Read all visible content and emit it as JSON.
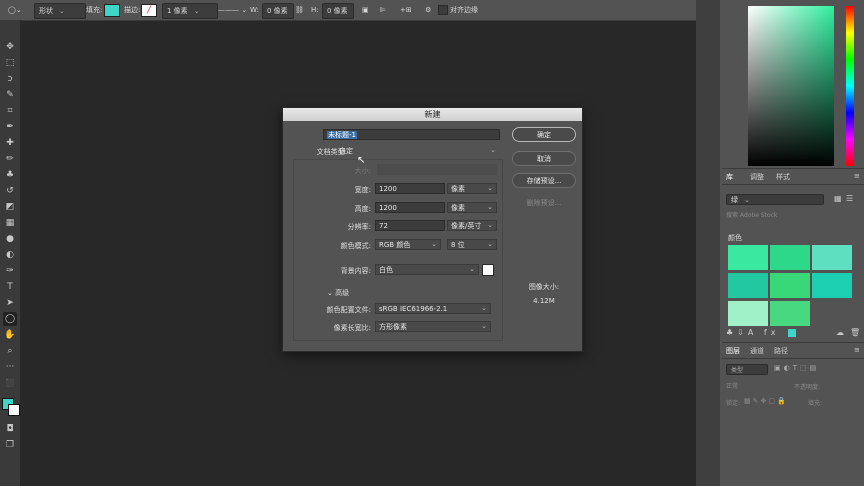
{
  "optionsbar": {
    "mode": "形状",
    "fill_label": "填充:",
    "stroke_label": "描边:",
    "stroke_width": "1 像素",
    "w_label": "W:",
    "w_value": "0 像素",
    "h_label": "H:",
    "h_value": "0 像素",
    "align_edges": "对齐边缘",
    "fill_color": "#3fd4c8"
  },
  "dialog": {
    "title": "新建",
    "name_label": "名称:",
    "name_value": "未标题-1",
    "doctype_label": "文档类型:",
    "doctype_value": "自定",
    "size_label": "大小:",
    "width_label": "宽度:",
    "width_value": "1200",
    "width_unit": "像素",
    "height_label": "高度:",
    "height_value": "1200",
    "height_unit": "像素",
    "resolution_label": "分辨率:",
    "resolution_value": "72",
    "resolution_unit": "像素/英寸",
    "colormode_label": "颜色模式:",
    "colormode_value": "RGB 颜色",
    "bitdepth_value": "8 位",
    "bg_label": "背景内容:",
    "bg_value": "白色",
    "advanced_label": "高级",
    "profile_label": "颜色配置文件:",
    "profile_value": "sRGB IEC61966-2.1",
    "aspect_label": "像素长宽比:",
    "aspect_value": "方形像素",
    "ok_label": "确定",
    "cancel_label": "取消",
    "save_preset_label": "存储预设...",
    "delete_preset_label": "删除预设...",
    "image_size_label": "图像大小:",
    "image_size_value": "4.12M"
  },
  "libraries": {
    "tabs": [
      "库",
      "调整",
      "样式"
    ],
    "dropdown_value": "绿",
    "search_placeholder": "搜索 Adobe Stock",
    "colors_header": "颜色",
    "swatches": [
      "#3ae8a0",
      "#2ed88a",
      "#5ee0c0",
      "#22c8a0",
      "#38d878",
      "#1ad0b0",
      "#a0f0c8",
      "#48d880"
    ]
  },
  "layers": {
    "tabs": [
      "图层",
      "通道",
      "路径"
    ],
    "kind_label": "类型",
    "blend_mode": "正常",
    "opacity_label": "不透明度:",
    "lock_label": "锁定:",
    "fill_label": "填充:"
  }
}
